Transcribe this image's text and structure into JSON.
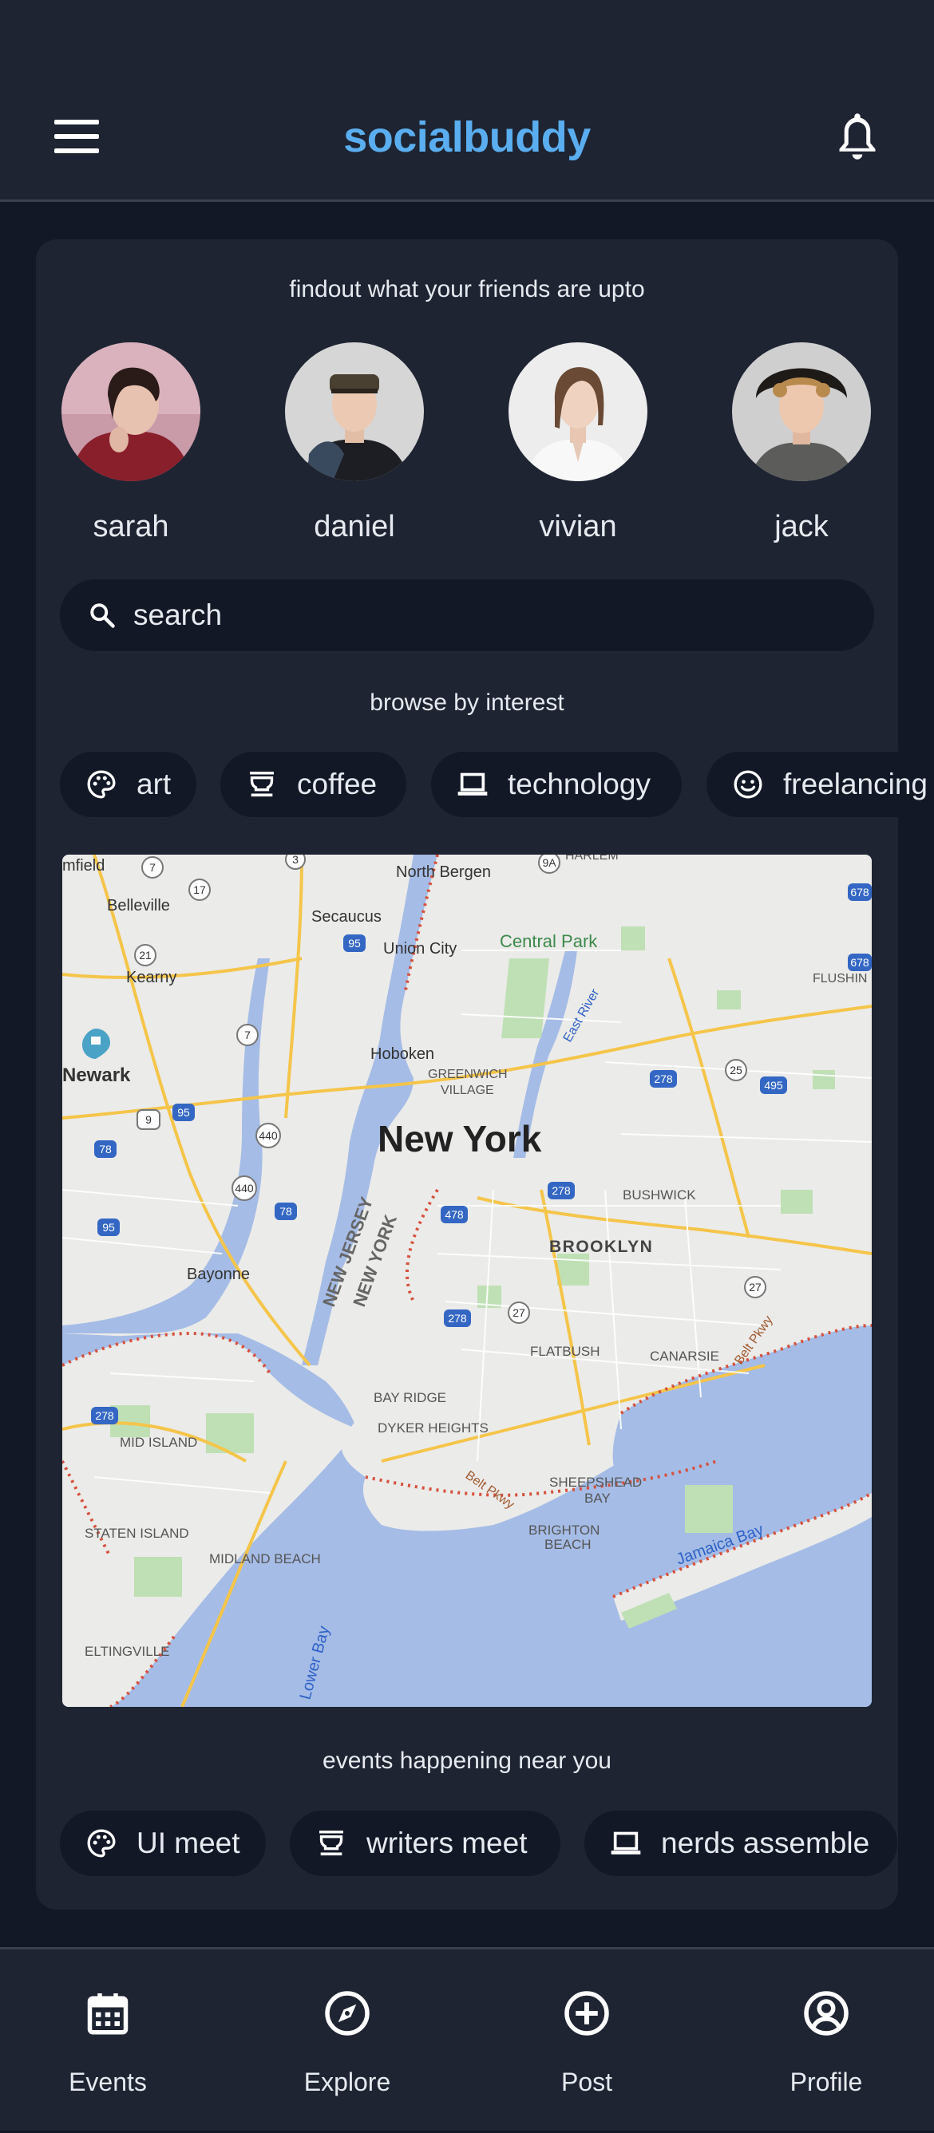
{
  "header": {
    "title": "socialbuddy",
    "menu_icon": "hamburger-menu-icon",
    "notification_icon": "bell-icon"
  },
  "friends_section": {
    "caption": "findout what your friends are upto",
    "friends": [
      {
        "name": "sarah"
      },
      {
        "name": "daniel"
      },
      {
        "name": "vivian"
      },
      {
        "name": "jack"
      }
    ]
  },
  "search": {
    "placeholder": "search",
    "icon": "search-icon"
  },
  "interests": {
    "caption": "browse by interest",
    "items": [
      {
        "label": "art",
        "icon": "palette-icon"
      },
      {
        "label": "coffee",
        "icon": "coffee-cup-icon"
      },
      {
        "label": "technology",
        "icon": "laptop-icon"
      },
      {
        "label": "freelancing",
        "icon": "smiley-icon"
      }
    ]
  },
  "map": {
    "labels": {
      "city": "New York",
      "brooklyn": "BROOKLYN",
      "bushwick": "BUSHWICK",
      "hoboken": "Hoboken",
      "greenwich": "GREENWICH",
      "village": "VILLAGE",
      "newark": "Newark",
      "bayonne": "Bayonne",
      "central_park": "Central Park",
      "union_city": "Union City",
      "secaucus": "Secaucus",
      "north_bergen": "North Bergen",
      "belleville": "Belleville",
      "kearny": "Kearny",
      "new_jersey": "NEW JERSEY",
      "new_york_state": "NEW YORK",
      "flatbush": "FLATBUSH",
      "canarsie": "CANARSIE",
      "bay_ridge": "BAY RIDGE",
      "dyker_heights": "DYKER HEIGHTS",
      "sheepshead": "SHEEPSHEAD",
      "bay": "BAY",
      "brighton": "BRIGHTON",
      "beach": "BEACH",
      "mid_island": "MID ISLAND",
      "staten_island": "STATEN ISLAND",
      "midland_beach": "MIDLAND BEACH",
      "eltingville": "ELTINGVILLE",
      "jamaica_bay": "Jamaica Bay",
      "lower_bay": "Lower Bay",
      "east_river": "East River",
      "belt_pkwy": "Belt Pkwy",
      "flushing": "FLUSHIN",
      "harlem": "HARLEM",
      "bloomfield": "mfield"
    },
    "shields": {
      "s1": "7",
      "s2": "17",
      "s3": "3",
      "s4": "9A",
      "s5": "678",
      "s6": "95",
      "s7": "21",
      "s8": "7",
      "s9": "9",
      "s10": "95",
      "s11": "440",
      "s12": "440",
      "s13": "78",
      "s14": "78",
      "s15": "95",
      "s16": "478",
      "s17": "278",
      "s18": "278",
      "s19": "27",
      "s20": "278",
      "s21": "25",
      "s22": "495",
      "s23": "27",
      "s24": "278",
      "s25": "678"
    }
  },
  "events": {
    "caption": "events happening near you",
    "items": [
      {
        "label": "UI meet",
        "icon": "palette-icon"
      },
      {
        "label": "writers meet",
        "icon": "coffee-cup-icon"
      },
      {
        "label": "nerds assemble",
        "icon": "laptop-icon"
      }
    ]
  },
  "bottom_nav": {
    "items": [
      {
        "label": "Events",
        "icon": "calendar-icon"
      },
      {
        "label": "Explore",
        "icon": "compass-icon"
      },
      {
        "label": "Post",
        "icon": "plus-circle-icon"
      },
      {
        "label": "Profile",
        "icon": "user-circle-icon"
      }
    ]
  },
  "colors": {
    "background": "#121826",
    "surface": "#1e2432",
    "brand": "#5aaeef",
    "text": "#e6eaf0"
  }
}
